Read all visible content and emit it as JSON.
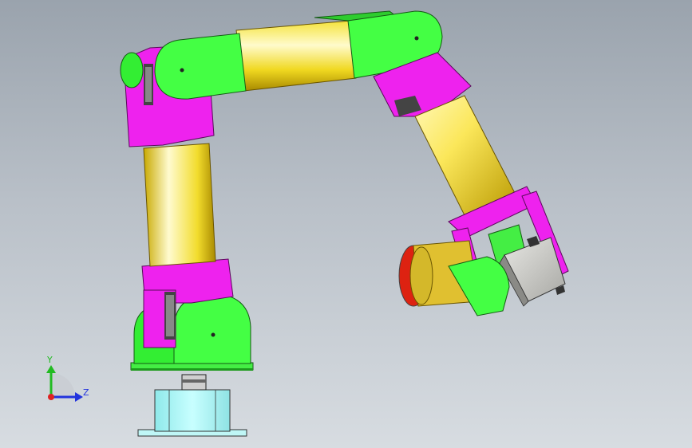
{
  "view": {
    "background_top": "#9aa3ad",
    "background_bottom": "#d7dce1"
  },
  "parts": {
    "link_color": "#fff38a",
    "joint_color": "#33ee33",
    "bracket_color": "#ee22ee",
    "motor_color": "#d0d0cc",
    "base_color": "#a8f2f0",
    "cap_color": "#dd2211"
  },
  "triad": {
    "y_label": "Y",
    "z_label": "Z",
    "y_color": "#22bb22",
    "z_color": "#2233dd",
    "origin_color": "#dd2222"
  }
}
